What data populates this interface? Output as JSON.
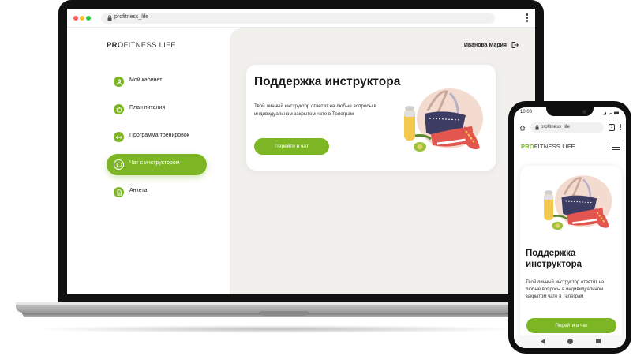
{
  "desktop": {
    "browser": {
      "url": "profitness_life"
    },
    "logo": {
      "bold": "PRO",
      "rest": "FITNESS LIFE"
    },
    "nav": [
      {
        "label": "Мой кабинет",
        "active": false,
        "icon": "user-icon"
      },
      {
        "label": "План питания",
        "active": false,
        "icon": "apple-icon"
      },
      {
        "label": "Программа тренировок",
        "active": false,
        "icon": "dumbbell-icon"
      },
      {
        "label": "Чат с инструктором",
        "active": true,
        "icon": "chat-icon"
      },
      {
        "label": "Анкета",
        "active": false,
        "icon": "document-icon"
      }
    ],
    "user_name": "Иванова Мария",
    "card": {
      "title": "Поддержка инструктора",
      "text": "Твой личный инструктор ответит на любые вопросы в индивидуальном закрытом чате в Телеграм",
      "button": "Перейти в чат"
    }
  },
  "mobile": {
    "status_time": "10:00",
    "browser": {
      "url": "profitness_life",
      "tab_count": "1"
    },
    "logo": {
      "bold": "PRO",
      "rest": "FITNESS LIFE"
    },
    "card": {
      "title": "Поддержка инструктора",
      "text": "Твой личный инструктор ответит на любые вопросы в индивидуальном закрытом чате в Телеграм",
      "button": "Перейти в чат"
    }
  },
  "colors": {
    "accent": "#7db624",
    "panel": "#f1f0ec"
  }
}
